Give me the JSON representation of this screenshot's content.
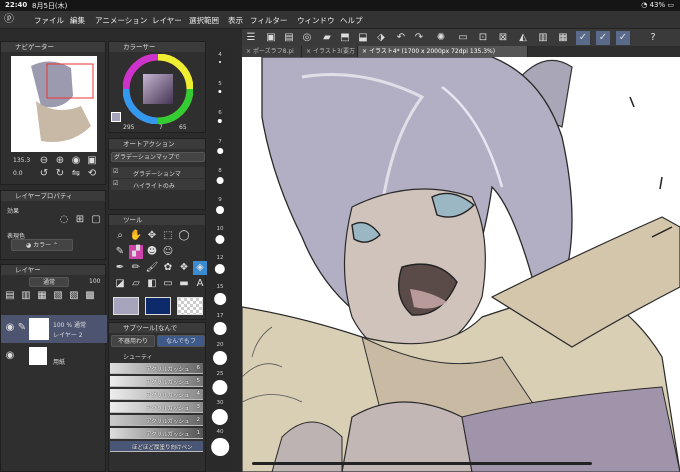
{
  "status": {
    "time": "22:40",
    "date": "8月5日(木)",
    "battery": "43%"
  },
  "menu": [
    "ファイル",
    "編集",
    "アニメーション",
    "レイヤー",
    "選択範囲",
    "表示",
    "フィルター",
    "ウィンドウ",
    "ヘルプ"
  ],
  "tabs": [
    "ポーズラフ8.pi",
    "イラスト3(要万",
    "イラスト4* (1700 x 2000px 72dpi 135.3%)"
  ],
  "navigator": {
    "title": "ナビゲーター",
    "zoom": "135.3",
    "angle": "0.0"
  },
  "layer_property": {
    "title": "レイヤープロパティ",
    "effect_label": "効果",
    "display_color_label": "表現色",
    "display_color_value": "カラー"
  },
  "layer": {
    "title": "レイヤー",
    "blend_mode": "通常",
    "opacity": "100",
    "items": [
      {
        "opacity_text": "100 % 通常",
        "name": "レイヤー 2"
      },
      {
        "opacity_text": "",
        "name": "用紙"
      }
    ]
  },
  "color": {
    "title": "カラーサー",
    "h": "295",
    "s": "7",
    "v": "65"
  },
  "auto_action": {
    "title": "オートアクション",
    "set_name": "グラデーションマップで",
    "items": [
      "グラデーションマ",
      "ハイライトのみ"
    ]
  },
  "tool": {
    "title": "ツール"
  },
  "subtool": {
    "title": "サブツール[なんで",
    "tabs": [
      "不器用わり",
      "なんでもフ"
    ],
    "group_label": "シューティ",
    "items": [
      {
        "name": "アクリルガッシュ",
        "num": "6"
      },
      {
        "name": "アクリルガッシュ",
        "num": "5"
      },
      {
        "name": "アクリルガッシュ",
        "num": "4"
      },
      {
        "name": "アクリルガッシュ",
        "num": "3"
      },
      {
        "name": "アクリルガッシュ",
        "num": "2"
      },
      {
        "name": "アクリルガッシュ",
        "num": "1"
      },
      {
        "name": "ほどほど厚塗り向けペン",
        "num": ""
      }
    ]
  },
  "brush_sizes": [
    "4",
    "5",
    "6",
    "7",
    "8",
    "9",
    "10",
    "12",
    "15",
    "17",
    "20",
    "25",
    "30",
    "40"
  ],
  "colors": {
    "main": "#a7a4bd",
    "sub": "#0d2a6b"
  }
}
